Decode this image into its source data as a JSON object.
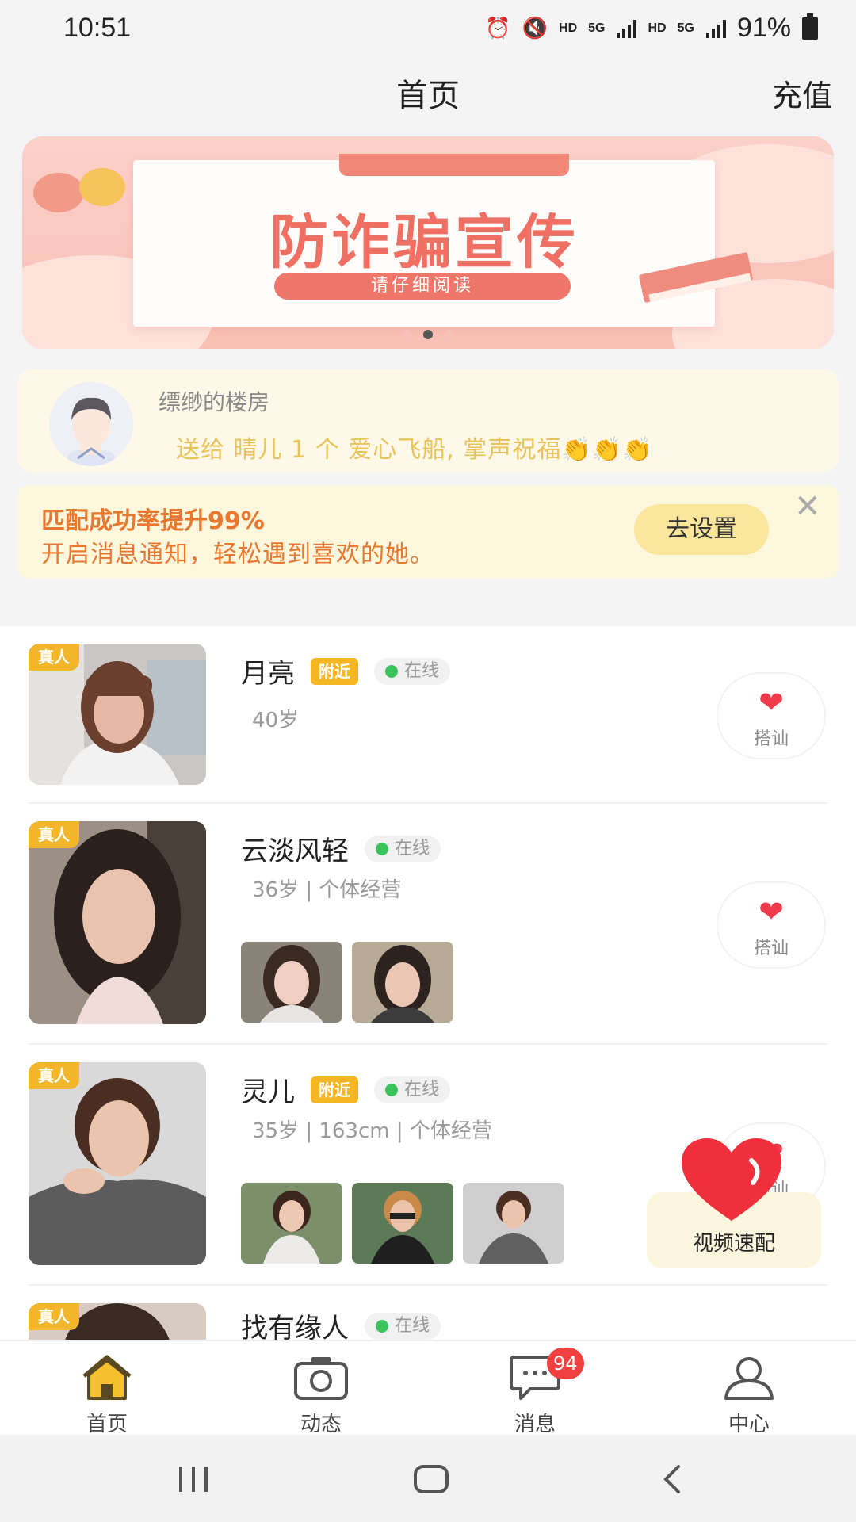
{
  "status_bar": {
    "time": "10:51",
    "battery": "91%",
    "hd1": "HD",
    "net1": "5G",
    "hd2": "HD",
    "net2": "5G"
  },
  "header": {
    "title": "首页",
    "recharge": "充值"
  },
  "banner": {
    "title": "防诈骗宣传",
    "subtitle": "请仔细阅读",
    "page_count": 3,
    "active_page": 2
  },
  "notice": {
    "sender": "缥缈的楼房",
    "message": "送给 晴儿 1 个 爱心飞船, 掌声祝福👏👏👏"
  },
  "tip": {
    "title": "匹配成功率提升99%",
    "subtitle": "开启消息通知，轻松遇到喜欢的她。",
    "button": "去设置",
    "close": "✕"
  },
  "list": {
    "real_badge": "真人",
    "near_badge": "附近",
    "online_text": "在线",
    "like_label": "搭讪",
    "items": [
      {
        "name": "月亮",
        "near": true,
        "info": "40岁",
        "thumbs": 0
      },
      {
        "name": "云淡风轻",
        "near": false,
        "info": "36岁 | 个体经营",
        "thumbs": 2
      },
      {
        "name": "灵儿",
        "near": true,
        "info": "35岁 | 163cm | 个体经营",
        "thumbs": 3
      },
      {
        "name": "找有缘人",
        "near": false,
        "info": "",
        "thumbs": 0
      }
    ]
  },
  "video_match": {
    "label": "视频速配"
  },
  "bottom_nav": {
    "items": [
      {
        "label": "首页",
        "icon": "home-icon",
        "active": true
      },
      {
        "label": "动态",
        "icon": "camera-icon",
        "active": false
      },
      {
        "label": "消息",
        "icon": "message-icon",
        "active": false,
        "badge": "94"
      },
      {
        "label": "中心",
        "icon": "user-icon",
        "active": false
      }
    ]
  },
  "colors": {
    "accent_yellow": "#f5b623",
    "like_red": "#ee3a4b",
    "online_green": "#3dc35b",
    "tip_orange": "#e8782f",
    "banner_pink": "#ef6f63"
  }
}
